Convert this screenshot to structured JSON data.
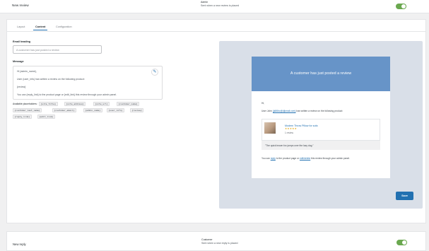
{
  "new_review": {
    "title": "New review",
    "recipient": "Admin",
    "description": "Sent when a new review is placed",
    "enabled": true
  },
  "tabs": [
    "Layout",
    "Content",
    "Configuration"
  ],
  "active_tab": "Content",
  "email_heading": {
    "label": "Email heading",
    "value": "A customer has just posted a review"
  },
  "message": {
    "label": "Message",
    "lines": [
      "Hi {admin_name},",
      "User {user_info} has written a review on the following product:",
      "{review}",
      "You can {reply_link} to the product page or {edit_link} this review through your admin panel."
    ]
  },
  "placeholders": {
    "label": "Available placeholders:",
    "chips": [
      "{site_title}",
      "{site_address}",
      "{site_url}",
      "{customer_name}",
      "{customer_last_name}",
      "{customer_email}",
      "{admin_name}",
      "{user_info}",
      "{review}",
      "{reply_link}",
      "{edit_link}"
    ]
  },
  "preview": {
    "heading": "A customer has just posted a review",
    "greeting": "Hi,",
    "intro_user": "User John",
    "intro_email": "(jk86bc@djkmail.com)",
    "intro_rest": "has written a review on the following product:",
    "product_name": "Modern Throw Pillow for sofa",
    "stars": "★★★★★",
    "review_count": "1 review",
    "quote": "\"The quick brown fox jumps over the lazy dog.\"",
    "footer_pre": "You can",
    "footer_reply": "reply",
    "footer_mid": "to the product page or",
    "footer_edit": "edit/delete",
    "footer_post": "this review through your admin panel."
  },
  "save_label": "Save",
  "new_reply": {
    "title": "New reply",
    "recipient": "Customer",
    "description": "Sent when a new reply is placed",
    "enabled": true
  },
  "colors": {
    "toggle_on": "#6aa84f",
    "header": "#6794c8",
    "primary": "#2271b1"
  }
}
